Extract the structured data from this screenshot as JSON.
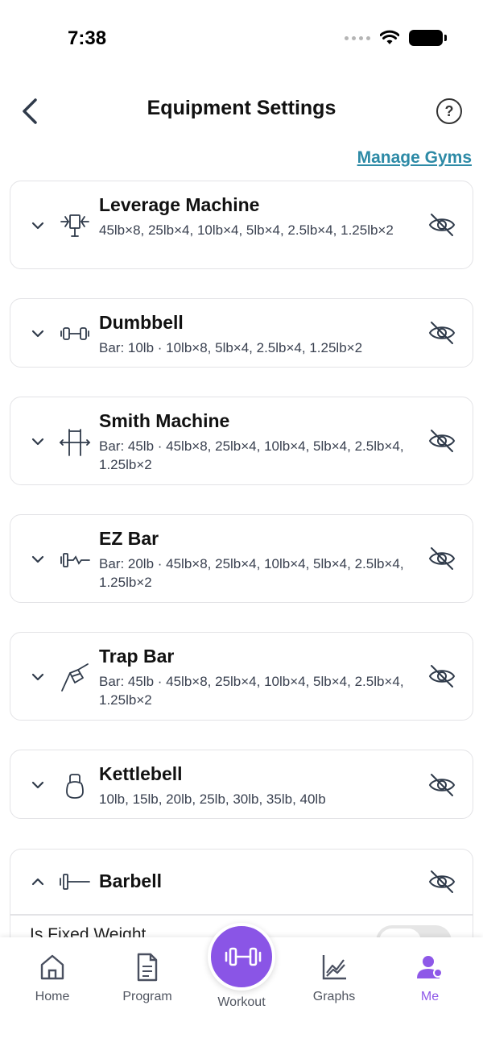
{
  "status": {
    "time": "7:38"
  },
  "header": {
    "title": "Equipment Settings",
    "help": "?"
  },
  "manage_gyms": "Manage Gyms",
  "equipment": [
    {
      "name": "Leverage Machine",
      "description": "45lb×8, 25lb×4, 10lb×4, 5lb×4, 2.5lb×4, 1.25lb×2",
      "icon": "leverage-machine-icon",
      "expanded": false
    },
    {
      "name": "Dumbbell",
      "description": "Bar: 10lb · 10lb×8, 5lb×4, 2.5lb×4, 1.25lb×2",
      "icon": "dumbbell-icon",
      "expanded": false
    },
    {
      "name": "Smith Machine",
      "description": "Bar: 45lb · 45lb×8, 25lb×4, 10lb×4, 5lb×4, 2.5lb×4, 1.25lb×2",
      "icon": "smith-machine-icon",
      "expanded": false
    },
    {
      "name": "EZ Bar",
      "description": "Bar: 20lb · 45lb×8, 25lb×4, 10lb×4, 5lb×4, 2.5lb×4, 1.25lb×2",
      "icon": "ez-bar-icon",
      "expanded": false
    },
    {
      "name": "Trap Bar",
      "description": "Bar: 45lb · 45lb×8, 25lb×4, 10lb×4, 5lb×4, 2.5lb×4, 1.25lb×2",
      "icon": "trap-bar-icon",
      "expanded": false
    },
    {
      "name": "Kettlebell",
      "description": "10lb, 15lb, 20lb, 25lb, 30lb, 35lb, 40lb",
      "icon": "kettlebell-icon",
      "expanded": false
    },
    {
      "name": "Barbell",
      "description": "",
      "icon": "barbell-icon",
      "expanded": true,
      "fixed_weight_label": "Is Fixed Weight",
      "fixed_weight": false
    }
  ],
  "tabs": [
    {
      "label": "Home",
      "icon": "home-icon",
      "active": false
    },
    {
      "label": "Program",
      "icon": "document-icon",
      "active": false
    },
    {
      "label": "Workout",
      "icon": "dumbbell-icon",
      "active": false
    },
    {
      "label": "Graphs",
      "icon": "graph-icon",
      "active": false
    },
    {
      "label": "Me",
      "icon": "profile-icon",
      "active": true
    }
  ],
  "colors": {
    "accent": "#8a55e6",
    "link": "#2d8aa6",
    "text_secondary": "#3a4150",
    "border": "#e3e3e6"
  }
}
